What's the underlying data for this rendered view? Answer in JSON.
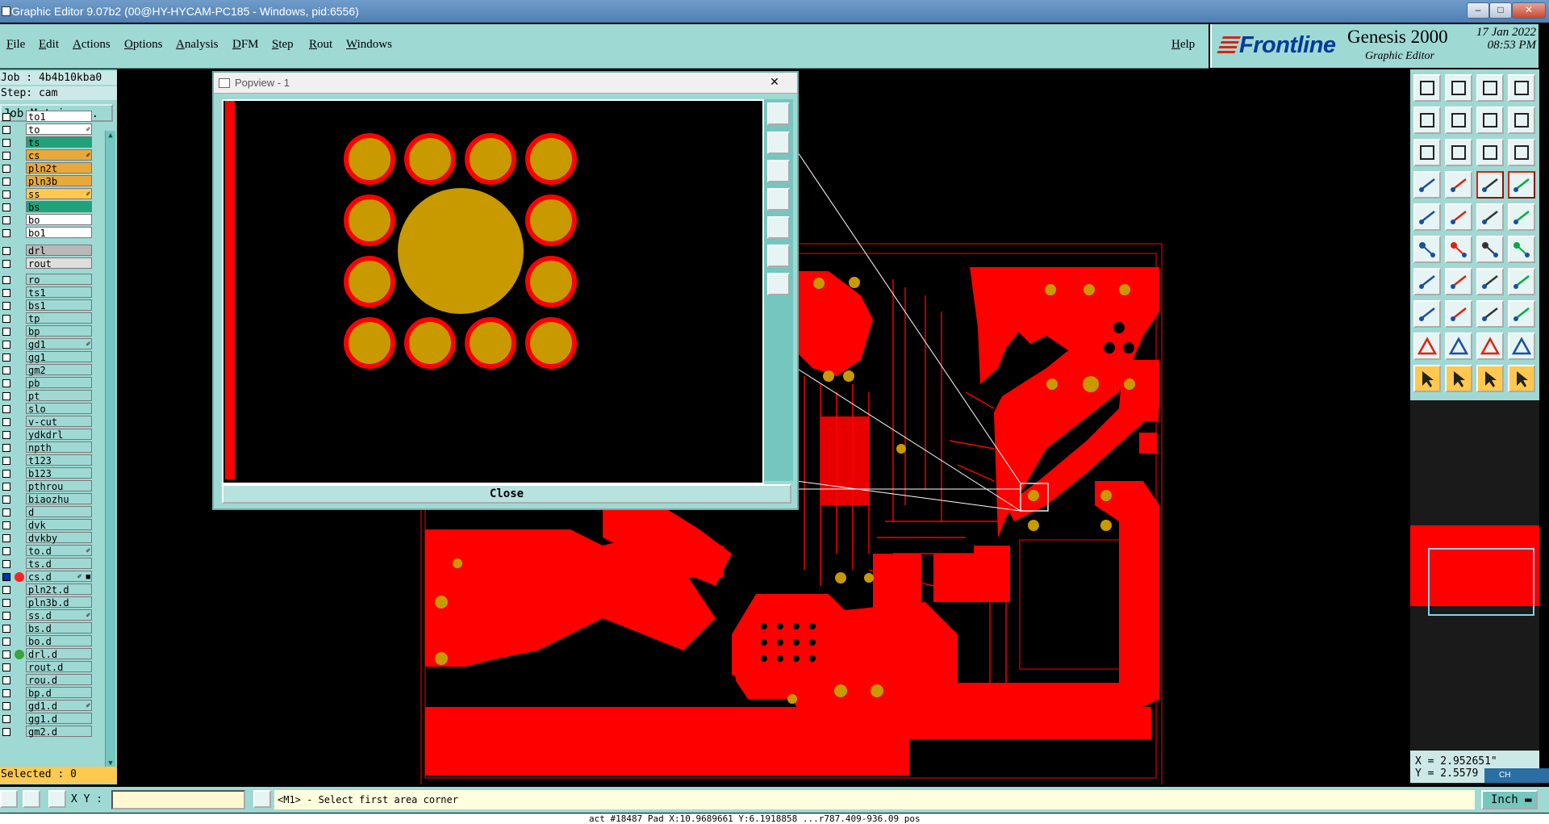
{
  "window": {
    "title": "Graphic Editor 9.07b2 (00@HY-HYCAM-PC185 - Windows, pid:6556)"
  },
  "menu": {
    "items": [
      "File",
      "Edit",
      "Actions",
      "Options",
      "Analysis",
      "DFM",
      "Step",
      "Rout",
      "Windows"
    ],
    "help": "Help"
  },
  "brand": {
    "logo": "Frontline",
    "product": "Genesis 2000",
    "subtitle": "Graphic Editor",
    "date": "17 Jan 2022",
    "time": "08:53 PM"
  },
  "job": {
    "job": "Job : 4b4b10kba0",
    "step": "Step: cam",
    "matrix_button": "Job Matrix ..."
  },
  "layers": [
    {
      "name": "to1",
      "bg": "#ffffff",
      "mark": ""
    },
    {
      "name": "to",
      "bg": "#ffffff",
      "mark": "✐"
    },
    {
      "name": "ts",
      "bg": "#1fa27a",
      "mark": ""
    },
    {
      "name": "cs",
      "bg": "#e9a93a",
      "mark": "✐"
    },
    {
      "name": "pln2t",
      "bg": "#e9a93a",
      "mark": ""
    },
    {
      "name": "pln3b",
      "bg": "#e9a93a",
      "mark": ""
    },
    {
      "name": "ss",
      "bg": "#ffc94f",
      "mark": "✐"
    },
    {
      "name": "bs",
      "bg": "#1fa27a",
      "mark": ""
    },
    {
      "name": "bo",
      "bg": "#ffffff",
      "mark": ""
    },
    {
      "name": "bo1",
      "bg": "#ffffff",
      "mark": ""
    },
    {
      "name": "drl",
      "bg": "#b9b9b9",
      "mark": ""
    },
    {
      "name": "rout",
      "bg": "#dedede",
      "mark": ""
    },
    {
      "name": "ro",
      "bg": "#9fd9d4",
      "mark": ""
    },
    {
      "name": "ts1",
      "bg": "#9fd9d4",
      "mark": ""
    },
    {
      "name": "bs1",
      "bg": "#9fd9d4",
      "mark": ""
    },
    {
      "name": "tp",
      "bg": "#9fd9d4",
      "mark": ""
    },
    {
      "name": "bp",
      "bg": "#9fd9d4",
      "mark": ""
    },
    {
      "name": "gd1",
      "bg": "#9fd9d4",
      "mark": "✐"
    },
    {
      "name": "gg1",
      "bg": "#9fd9d4",
      "mark": ""
    },
    {
      "name": "gm2",
      "bg": "#9fd9d4",
      "mark": ""
    },
    {
      "name": "pb",
      "bg": "#9fd9d4",
      "mark": ""
    },
    {
      "name": "pt",
      "bg": "#9fd9d4",
      "mark": ""
    },
    {
      "name": "slo",
      "bg": "#9fd9d4",
      "mark": ""
    },
    {
      "name": "v-cut",
      "bg": "#9fd9d4",
      "mark": ""
    },
    {
      "name": "ydkdrl",
      "bg": "#9fd9d4",
      "mark": ""
    },
    {
      "name": "npth",
      "bg": "#9fd9d4",
      "mark": ""
    },
    {
      "name": "t123",
      "bg": "#9fd9d4",
      "mark": ""
    },
    {
      "name": "b123",
      "bg": "#9fd9d4",
      "mark": ""
    },
    {
      "name": "pthrou",
      "bg": "#9fd9d4",
      "mark": ""
    },
    {
      "name": "biaozhu",
      "bg": "#9fd9d4",
      "mark": ""
    },
    {
      "name": "d",
      "bg": "#9fd9d4",
      "mark": ""
    },
    {
      "name": "dvk",
      "bg": "#9fd9d4",
      "mark": ""
    },
    {
      "name": "dvkby",
      "bg": "#9fd9d4",
      "mark": ""
    },
    {
      "name": "to.d",
      "bg": "#9fd9d4",
      "mark": "✐"
    },
    {
      "name": "ts.d",
      "bg": "#9fd9d4",
      "mark": ""
    },
    {
      "name": "cs.d",
      "bg": "#9fd9d4",
      "mark": "✐ ■",
      "dot": "#ff2020",
      "active": true
    },
    {
      "name": "pln2t.d",
      "bg": "#9fd9d4",
      "mark": ""
    },
    {
      "name": "pln3b.d",
      "bg": "#9fd9d4",
      "mark": ""
    },
    {
      "name": "ss.d",
      "bg": "#9fd9d4",
      "mark": "✐"
    },
    {
      "name": "bs.d",
      "bg": "#9fd9d4",
      "mark": ""
    },
    {
      "name": "bo.d",
      "bg": "#9fd9d4",
      "mark": ""
    },
    {
      "name": "drl.d",
      "bg": "#9fd9d4",
      "mark": "",
      "dot": "#3aa33a"
    },
    {
      "name": "rout.d",
      "bg": "#9fd9d4",
      "mark": ""
    },
    {
      "name": "rou.d",
      "bg": "#9fd9d4",
      "mark": ""
    },
    {
      "name": "bp.d",
      "bg": "#9fd9d4",
      "mark": ""
    },
    {
      "name": "gd1.d",
      "bg": "#9fd9d4",
      "mark": "✐"
    },
    {
      "name": "gg1.d",
      "bg": "#9fd9d4",
      "mark": ""
    },
    {
      "name": "gm2.d",
      "bg": "#9fd9d4",
      "mark": ""
    }
  ],
  "selected": "Selected : 0",
  "popview": {
    "title": "Popview - 1",
    "close_x": "✕",
    "close_button": "Close"
  },
  "coords": {
    "x": "X = 2.952651\"",
    "y": "Y = 2.5579"
  },
  "bottom": {
    "xy_label": "X Y :",
    "prompt": "<M1> - Select first area corner",
    "unit": "Inch"
  },
  "status": "act #18487 Pad X:10.9689661 Y:6.1918858 ...r787.409-936.09 pos",
  "tray": "CH",
  "colors": {
    "copper": "#ff0000",
    "pad": "#c89a00",
    "panel": "#9fd9d4"
  }
}
